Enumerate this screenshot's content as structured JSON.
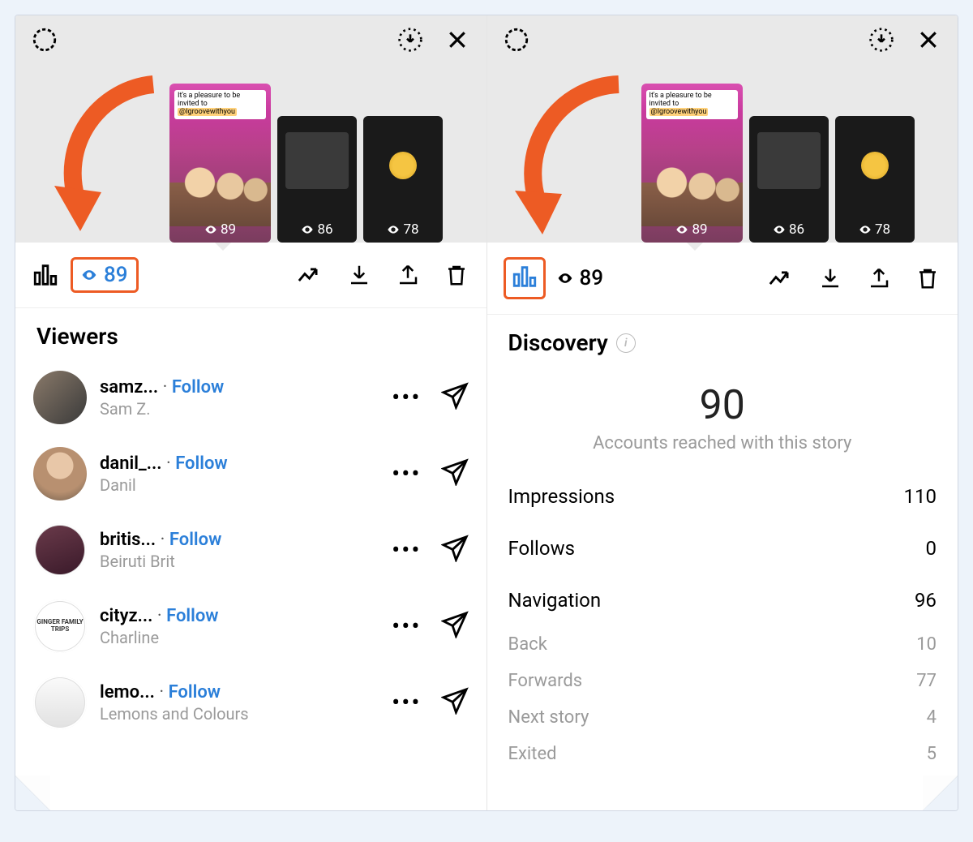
{
  "header": {
    "thumb_main_caption_l1": "It's a pleasure to be",
    "thumb_main_caption_l2": "invited to",
    "thumb_main_brand": "@Igroovewithyou",
    "thumb_main_views": "89",
    "thumb2_views": "86",
    "thumb3_views": "78"
  },
  "toolbar": {
    "views_count": "89"
  },
  "left_panel": {
    "title": "Viewers",
    "viewers": [
      {
        "username": "samz...",
        "full_name": "Sam Z.",
        "follow_label": "Follow",
        "avatar_bg": "linear-gradient(135deg,#8a7a6a,#3a3a3a)"
      },
      {
        "username": "danil_...",
        "full_name": "Danil",
        "follow_label": "Follow",
        "avatar_bg": "radial-gradient(circle at 50% 35%, #e8c7a8 30%, #b89070 31% 60%, #6a5a4a 100%)"
      },
      {
        "username": "britis...",
        "full_name": "Beiruti Brit",
        "follow_label": "Follow",
        "avatar_bg": "linear-gradient(160deg,#6a3a4a,#3a1a2a)",
        "ring": true
      },
      {
        "username": "cityz...",
        "full_name": "Charline",
        "follow_label": "Follow",
        "avatar_bg": "#ffffff",
        "ring": true,
        "text_logo": "GINGER FAMILY TRIPS"
      },
      {
        "username": "lemo...",
        "full_name": "Lemons and Colours",
        "follow_label": "Follow",
        "avatar_bg": "linear-gradient(180deg,#fafafa,#e2e2e2)",
        "ring": true
      }
    ]
  },
  "right_panel": {
    "title": "Discovery",
    "reach_number": "90",
    "reach_label": "Accounts reached with this story",
    "rows": [
      {
        "label": "Impressions",
        "value": "110"
      },
      {
        "label": "Follows",
        "value": "0"
      },
      {
        "label": "Navigation",
        "value": "96"
      }
    ],
    "nav_rows": [
      {
        "label": "Back",
        "value": "10"
      },
      {
        "label": "Forwards",
        "value": "77"
      },
      {
        "label": "Next story",
        "value": "4"
      },
      {
        "label": "Exited",
        "value": "5"
      }
    ]
  }
}
